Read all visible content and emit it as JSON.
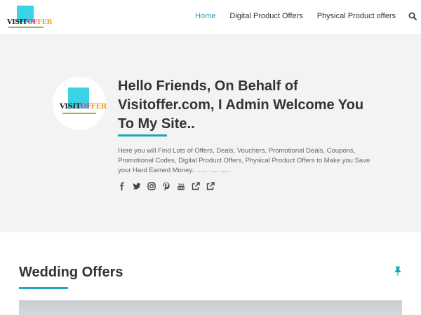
{
  "brand": {
    "logo_text_a": "VISIT",
    "logo_text_b": "OF",
    "logo_text_c": "FER"
  },
  "nav": {
    "items": [
      {
        "label": "Home",
        "active": true
      },
      {
        "label": "Digital Product Offers",
        "active": false
      },
      {
        "label": "Physical Product offers",
        "active": false
      }
    ],
    "search_icon": "search-icon"
  },
  "hero": {
    "title": "Hello Friends, On Behalf of Visitoffer.com, I Admin Welcome You To My Site..",
    "description": "Here you will Find Lots of Offers, Deals, Vouchers, Promotional Deals, Coupons, Promotional Codes, Digital Product Offers, Physical Product Offers to Make you Save your Hard Earned Money..",
    "dots": ".....    .....    .....",
    "social_icons": [
      "facebook-icon",
      "twitter-icon",
      "instagram-icon",
      "pinterest-icon",
      "youtube-icon",
      "external-link-icon",
      "external-link-icon"
    ]
  },
  "section": {
    "title": "Wedding Offers",
    "pin_icon": "pin-icon"
  },
  "colors": {
    "accent": "#1aa7bd",
    "logo_square": "#3cd2e6",
    "hero_bg": "#f3f3f3"
  }
}
